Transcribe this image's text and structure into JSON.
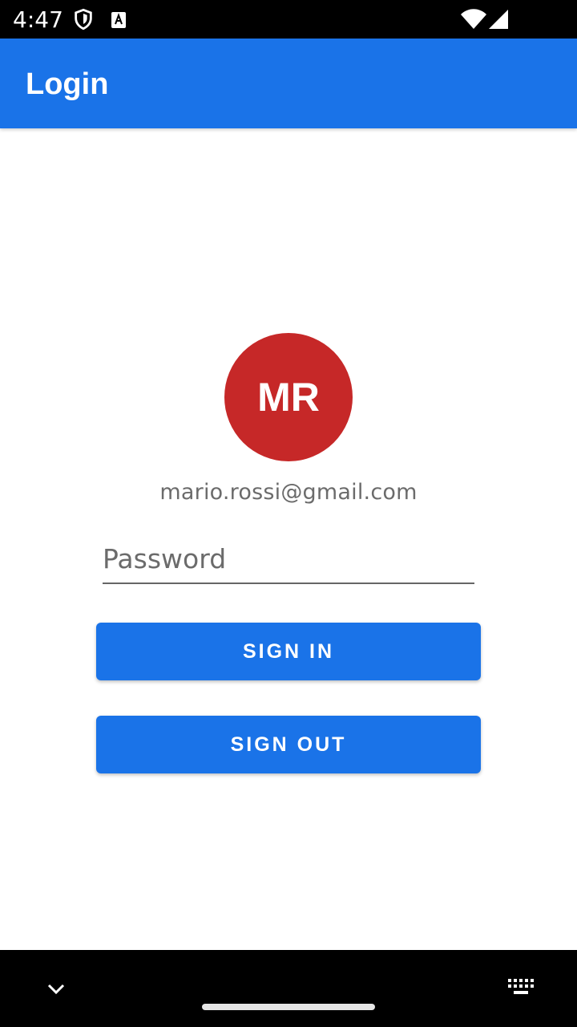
{
  "status_bar": {
    "time": "4:47",
    "icons": [
      "shield-icon",
      "a-notification-icon",
      "wifi-icon",
      "signal-icon"
    ]
  },
  "app_bar": {
    "title": "Login",
    "color": "#1a73e8"
  },
  "profile": {
    "initials": "MR",
    "avatar_color": "#c62828",
    "email": "mario.rossi@gmail.com"
  },
  "password": {
    "value": "",
    "placeholder": "Password"
  },
  "buttons": {
    "sign_in": "SIGN IN",
    "sign_out": "SIGN OUT"
  },
  "nav_bar": {
    "icons": [
      "chevron-down-icon",
      "keyboard-icon"
    ]
  }
}
